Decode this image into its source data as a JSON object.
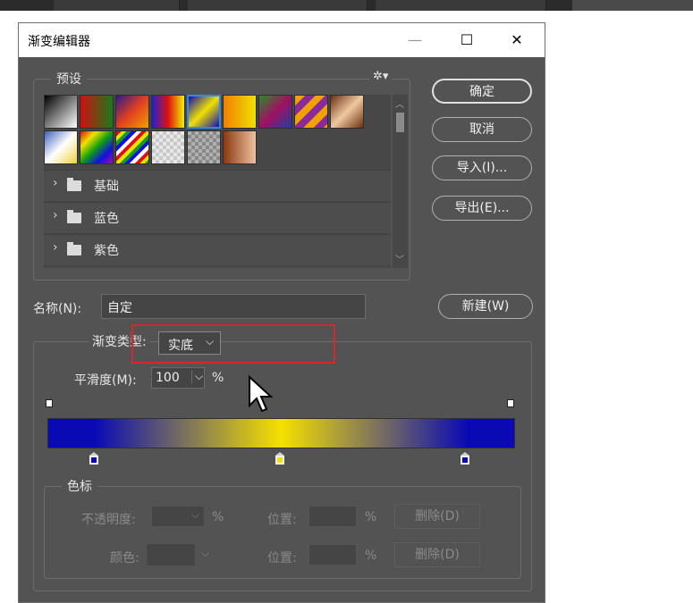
{
  "dialog": {
    "title": "渐变编辑器",
    "controls": {
      "minimize": "—",
      "maximize": "☐",
      "close": "✕"
    }
  },
  "presets": {
    "label": "预设",
    "settings_icon": "gear-icon",
    "folders": [
      "基础",
      "蓝色",
      "紫色"
    ]
  },
  "buttons": {
    "ok": "确定",
    "cancel": "取消",
    "import": "导入(I)...",
    "export": "导出(E)...",
    "new": "新建(W)"
  },
  "name": {
    "label": "名称(N):",
    "value": "自定"
  },
  "gradient_type": {
    "label": "渐变类型:",
    "value": "实底"
  },
  "smoothness": {
    "label": "平滑度(M):",
    "value": "100",
    "unit": "%"
  },
  "gradient_colors": {
    "blue": "#0a0ab4",
    "yellow": "#f5e000"
  },
  "color_stops": {
    "label": "色标",
    "opacity_label": "不透明度:",
    "opacity_unit": "%",
    "position_label": "位置:",
    "position_unit": "%",
    "delete_label": "删除(D)",
    "color_label": "颜色:",
    "position2_label": "位置:",
    "position2_unit": "%",
    "delete2_label": "删除(D)"
  },
  "highlight_color": "#d9262c"
}
